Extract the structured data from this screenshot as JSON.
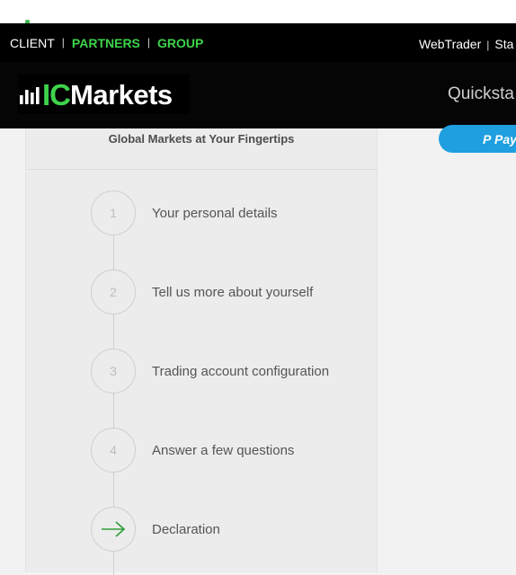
{
  "top_nav": {
    "links": [
      "CLIENT",
      "PARTNERS",
      "GROUP"
    ],
    "right_links": [
      "WebTrader",
      "Sta"
    ]
  },
  "brand": {
    "logo_ic": "IC",
    "logo_markets": "Markets"
  },
  "header": {
    "quickstart": "Quickstа"
  },
  "paypal": {
    "label": "Pay"
  },
  "card": {
    "tagline": "Global Markets at Your Fingertips"
  },
  "steps": [
    {
      "number": "1",
      "label": "Your personal details"
    },
    {
      "number": "2",
      "label": "Tell us more about yourself"
    },
    {
      "number": "3",
      "label": "Trading account configuration"
    },
    {
      "number": "4",
      "label": "Answer a few questions"
    },
    {
      "number": "",
      "label": "Declaration",
      "icon": "arrow-right-icon"
    }
  ],
  "colors": {
    "accent_green": "#3ed34b",
    "paypal_blue": "#1f9fe0",
    "nav_bg": "#000000"
  }
}
